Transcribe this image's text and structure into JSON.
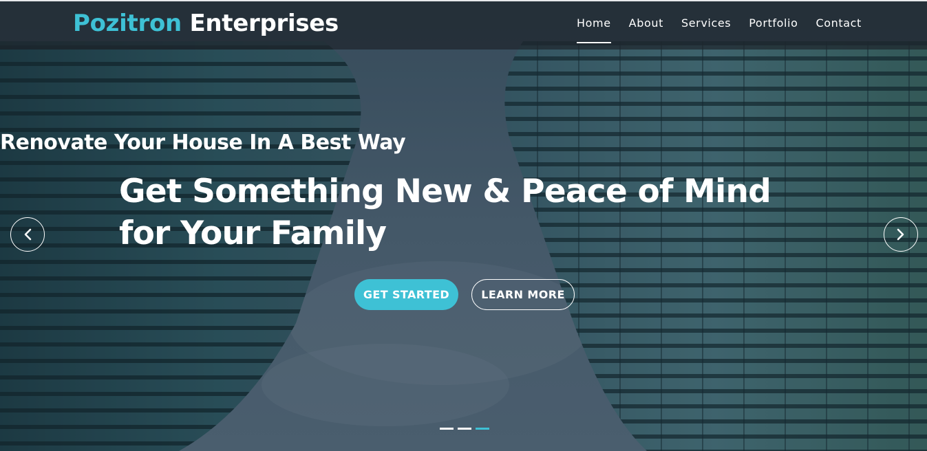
{
  "brand": {
    "part1": "Pozitron",
    "part2": " Enterprises"
  },
  "nav": {
    "items": [
      {
        "label": "Home",
        "active": true
      },
      {
        "label": "About"
      },
      {
        "label": "Services"
      },
      {
        "label": "Portfolio"
      },
      {
        "label": "Contact"
      }
    ]
  },
  "hero": {
    "subtitle": "Renovate Your House In A Best Way",
    "headline": "Get Something New & Peace of Mind for Your Family",
    "primary_button": "GET STARTED",
    "secondary_button": "LEARN MORE"
  },
  "carousel": {
    "slide_count": 3,
    "active_slide": 3,
    "prev_icon": "chevron-left-icon",
    "next_icon": "chevron-right-icon"
  },
  "colors": {
    "accent": "#3ec1d5",
    "text": "#ffffff",
    "navbar": "#1e262c"
  }
}
